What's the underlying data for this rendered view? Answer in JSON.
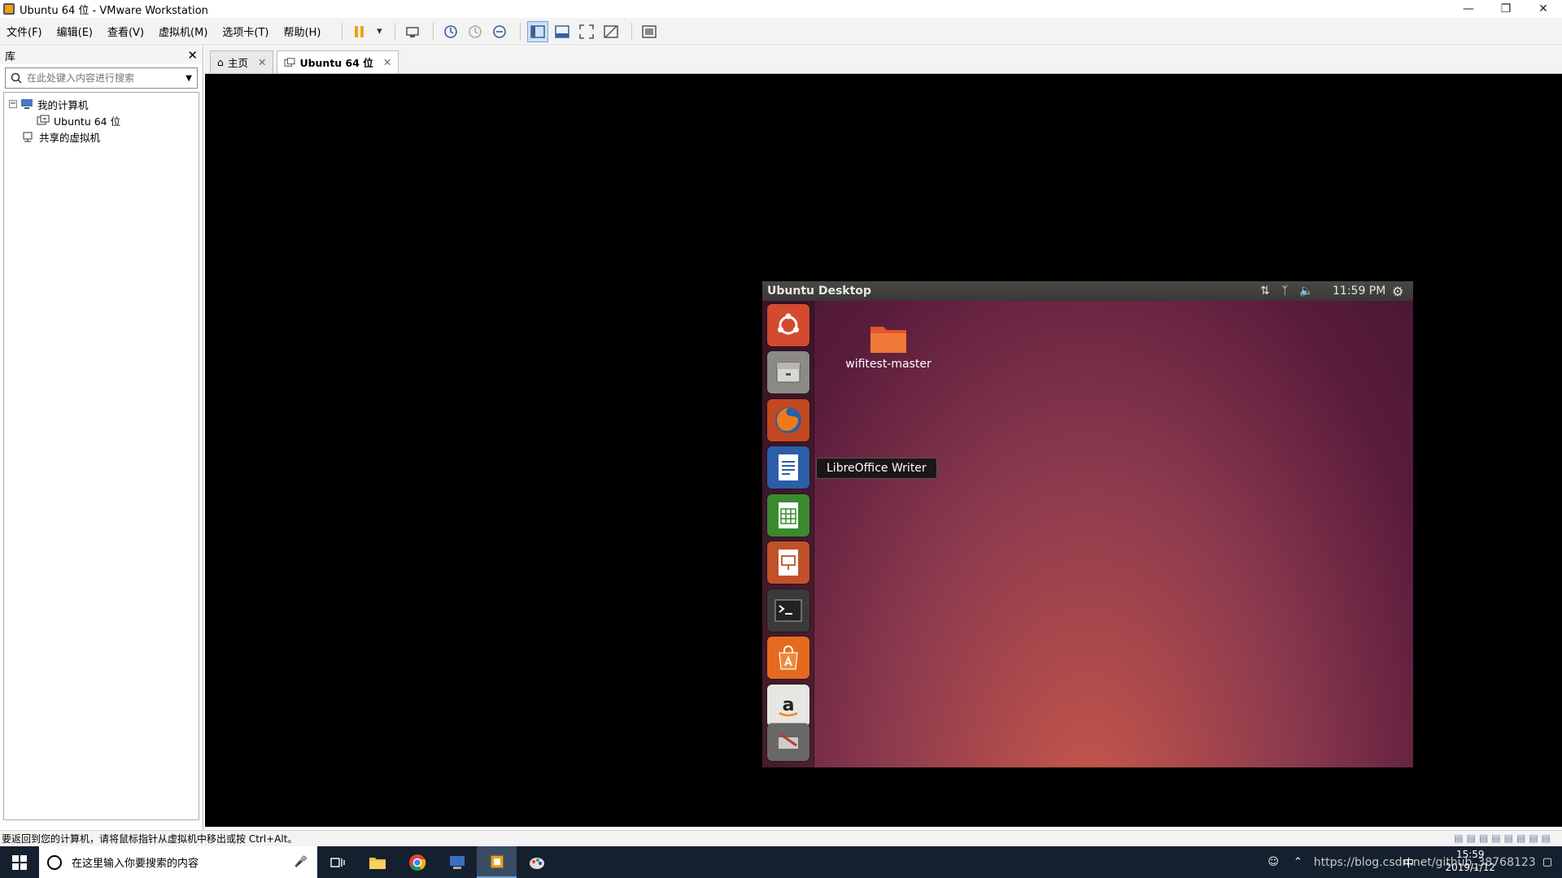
{
  "window": {
    "title": "Ubuntu 64 位 - VMware Workstation"
  },
  "menu": {
    "items": [
      "文件(F)",
      "编辑(E)",
      "查看(V)",
      "虚拟机(M)",
      "选项卡(T)",
      "帮助(H)"
    ]
  },
  "library": {
    "title": "库",
    "search_placeholder": "在此处键入内容进行搜索",
    "tree": {
      "my_computer": "我的计算机",
      "vm_name": "Ubuntu 64 位",
      "shared_vms": "共享的虚拟机"
    }
  },
  "tabs": [
    {
      "label": "主页",
      "active": false
    },
    {
      "label": "Ubuntu 64 位",
      "active": true
    }
  ],
  "ubuntu": {
    "panel_title": "Ubuntu Desktop",
    "time": "11:59 PM",
    "tooltip": "LibreOffice Writer",
    "desktop_folder": "wifitest-master",
    "launcher_icons": [
      "ubuntu-dash-icon",
      "files-icon",
      "firefox-icon",
      "libreoffice-writer-icon",
      "libreoffice-calc-icon",
      "libreoffice-impress-icon",
      "terminal-icon",
      "software-center-icon",
      "amazon-icon",
      "system-settings-icon"
    ]
  },
  "status_bar": {
    "text": "要返回到您的计算机，请将鼠标指针从虚拟机中移出或按 Ctrl+Alt。"
  },
  "taskbar": {
    "search_placeholder": "在这里输入你要搜索的内容",
    "clock_time": "15:59",
    "clock_date": "2019/1/12",
    "ime": "中",
    "watermark": "https://blog.csdn.net/github_38768123"
  }
}
